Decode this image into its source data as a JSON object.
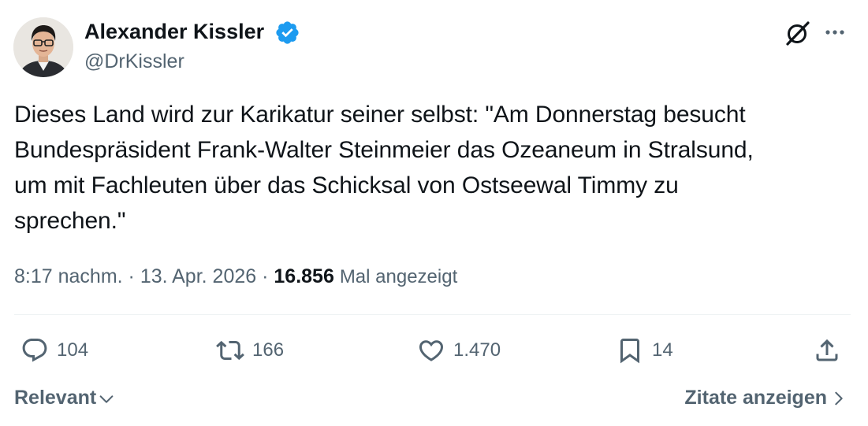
{
  "author": {
    "name": "Alexander Kissler",
    "handle": "@DrKissler",
    "verified": true,
    "verified_color": "#1d9bf0"
  },
  "tweet": {
    "text": "Dieses Land wird zur Karikatur seiner selbst: \"Am Donnerstag besucht\nBundespräsident Frank-Walter Steinmeier das Ozeaneum in Stralsund,\num mit Fachleuten über das Schicksal von Ostseewal Timmy zu\nsprechen.\""
  },
  "meta": {
    "time": "8:17 nachm.",
    "separator": " · ",
    "date": "13. Apr. 2026",
    "views_count": "16.856",
    "views_label": "Mal angezeigt"
  },
  "actions": {
    "reply": {
      "icon": "reply-icon",
      "count": "104"
    },
    "retweet": {
      "icon": "retweet-icon",
      "count": "166"
    },
    "like": {
      "icon": "heart-icon",
      "count": "1.470"
    },
    "bookmark": {
      "icon": "bookmark-icon",
      "count": "14"
    },
    "share": {
      "icon": "share-icon"
    }
  },
  "footer": {
    "sort_label": "Relevant",
    "quotes_label": "Zitate anzeigen"
  },
  "icons": {
    "header_right": [
      "grok-icon",
      "more-icon"
    ]
  },
  "colors": {
    "text": "#0f1419",
    "secondary": "#536471",
    "divider": "#eff3f4"
  }
}
